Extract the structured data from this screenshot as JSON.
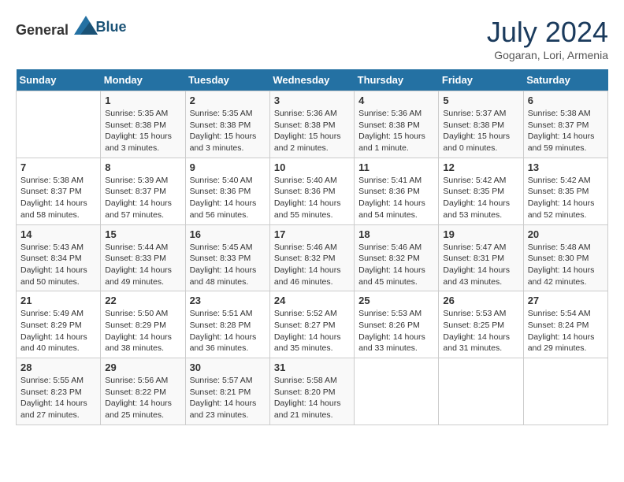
{
  "logo": {
    "general": "General",
    "blue": "Blue"
  },
  "title": {
    "month_year": "July 2024",
    "location": "Gogaran, Lori, Armenia"
  },
  "weekdays": [
    "Sunday",
    "Monday",
    "Tuesday",
    "Wednesday",
    "Thursday",
    "Friday",
    "Saturday"
  ],
  "weeks": [
    [
      {
        "day": "",
        "sunrise": "",
        "sunset": "",
        "daylight": ""
      },
      {
        "day": "1",
        "sunrise": "Sunrise: 5:35 AM",
        "sunset": "Sunset: 8:38 PM",
        "daylight": "Daylight: 15 hours and 3 minutes."
      },
      {
        "day": "2",
        "sunrise": "Sunrise: 5:35 AM",
        "sunset": "Sunset: 8:38 PM",
        "daylight": "Daylight: 15 hours and 3 minutes."
      },
      {
        "day": "3",
        "sunrise": "Sunrise: 5:36 AM",
        "sunset": "Sunset: 8:38 PM",
        "daylight": "Daylight: 15 hours and 2 minutes."
      },
      {
        "day": "4",
        "sunrise": "Sunrise: 5:36 AM",
        "sunset": "Sunset: 8:38 PM",
        "daylight": "Daylight: 15 hours and 1 minute."
      },
      {
        "day": "5",
        "sunrise": "Sunrise: 5:37 AM",
        "sunset": "Sunset: 8:38 PM",
        "daylight": "Daylight: 15 hours and 0 minutes."
      },
      {
        "day": "6",
        "sunrise": "Sunrise: 5:38 AM",
        "sunset": "Sunset: 8:37 PM",
        "daylight": "Daylight: 14 hours and 59 minutes."
      }
    ],
    [
      {
        "day": "7",
        "sunrise": "Sunrise: 5:38 AM",
        "sunset": "Sunset: 8:37 PM",
        "daylight": "Daylight: 14 hours and 58 minutes."
      },
      {
        "day": "8",
        "sunrise": "Sunrise: 5:39 AM",
        "sunset": "Sunset: 8:37 PM",
        "daylight": "Daylight: 14 hours and 57 minutes."
      },
      {
        "day": "9",
        "sunrise": "Sunrise: 5:40 AM",
        "sunset": "Sunset: 8:36 PM",
        "daylight": "Daylight: 14 hours and 56 minutes."
      },
      {
        "day": "10",
        "sunrise": "Sunrise: 5:40 AM",
        "sunset": "Sunset: 8:36 PM",
        "daylight": "Daylight: 14 hours and 55 minutes."
      },
      {
        "day": "11",
        "sunrise": "Sunrise: 5:41 AM",
        "sunset": "Sunset: 8:36 PM",
        "daylight": "Daylight: 14 hours and 54 minutes."
      },
      {
        "day": "12",
        "sunrise": "Sunrise: 5:42 AM",
        "sunset": "Sunset: 8:35 PM",
        "daylight": "Daylight: 14 hours and 53 minutes."
      },
      {
        "day": "13",
        "sunrise": "Sunrise: 5:42 AM",
        "sunset": "Sunset: 8:35 PM",
        "daylight": "Daylight: 14 hours and 52 minutes."
      }
    ],
    [
      {
        "day": "14",
        "sunrise": "Sunrise: 5:43 AM",
        "sunset": "Sunset: 8:34 PM",
        "daylight": "Daylight: 14 hours and 50 minutes."
      },
      {
        "day": "15",
        "sunrise": "Sunrise: 5:44 AM",
        "sunset": "Sunset: 8:33 PM",
        "daylight": "Daylight: 14 hours and 49 minutes."
      },
      {
        "day": "16",
        "sunrise": "Sunrise: 5:45 AM",
        "sunset": "Sunset: 8:33 PM",
        "daylight": "Daylight: 14 hours and 48 minutes."
      },
      {
        "day": "17",
        "sunrise": "Sunrise: 5:46 AM",
        "sunset": "Sunset: 8:32 PM",
        "daylight": "Daylight: 14 hours and 46 minutes."
      },
      {
        "day": "18",
        "sunrise": "Sunrise: 5:46 AM",
        "sunset": "Sunset: 8:32 PM",
        "daylight": "Daylight: 14 hours and 45 minutes."
      },
      {
        "day": "19",
        "sunrise": "Sunrise: 5:47 AM",
        "sunset": "Sunset: 8:31 PM",
        "daylight": "Daylight: 14 hours and 43 minutes."
      },
      {
        "day": "20",
        "sunrise": "Sunrise: 5:48 AM",
        "sunset": "Sunset: 8:30 PM",
        "daylight": "Daylight: 14 hours and 42 minutes."
      }
    ],
    [
      {
        "day": "21",
        "sunrise": "Sunrise: 5:49 AM",
        "sunset": "Sunset: 8:29 PM",
        "daylight": "Daylight: 14 hours and 40 minutes."
      },
      {
        "day": "22",
        "sunrise": "Sunrise: 5:50 AM",
        "sunset": "Sunset: 8:29 PM",
        "daylight": "Daylight: 14 hours and 38 minutes."
      },
      {
        "day": "23",
        "sunrise": "Sunrise: 5:51 AM",
        "sunset": "Sunset: 8:28 PM",
        "daylight": "Daylight: 14 hours and 36 minutes."
      },
      {
        "day": "24",
        "sunrise": "Sunrise: 5:52 AM",
        "sunset": "Sunset: 8:27 PM",
        "daylight": "Daylight: 14 hours and 35 minutes."
      },
      {
        "day": "25",
        "sunrise": "Sunrise: 5:53 AM",
        "sunset": "Sunset: 8:26 PM",
        "daylight": "Daylight: 14 hours and 33 minutes."
      },
      {
        "day": "26",
        "sunrise": "Sunrise: 5:53 AM",
        "sunset": "Sunset: 8:25 PM",
        "daylight": "Daylight: 14 hours and 31 minutes."
      },
      {
        "day": "27",
        "sunrise": "Sunrise: 5:54 AM",
        "sunset": "Sunset: 8:24 PM",
        "daylight": "Daylight: 14 hours and 29 minutes."
      }
    ],
    [
      {
        "day": "28",
        "sunrise": "Sunrise: 5:55 AM",
        "sunset": "Sunset: 8:23 PM",
        "daylight": "Daylight: 14 hours and 27 minutes."
      },
      {
        "day": "29",
        "sunrise": "Sunrise: 5:56 AM",
        "sunset": "Sunset: 8:22 PM",
        "daylight": "Daylight: 14 hours and 25 minutes."
      },
      {
        "day": "30",
        "sunrise": "Sunrise: 5:57 AM",
        "sunset": "Sunset: 8:21 PM",
        "daylight": "Daylight: 14 hours and 23 minutes."
      },
      {
        "day": "31",
        "sunrise": "Sunrise: 5:58 AM",
        "sunset": "Sunset: 8:20 PM",
        "daylight": "Daylight: 14 hours and 21 minutes."
      },
      {
        "day": "",
        "sunrise": "",
        "sunset": "",
        "daylight": ""
      },
      {
        "day": "",
        "sunrise": "",
        "sunset": "",
        "daylight": ""
      },
      {
        "day": "",
        "sunrise": "",
        "sunset": "",
        "daylight": ""
      }
    ]
  ]
}
